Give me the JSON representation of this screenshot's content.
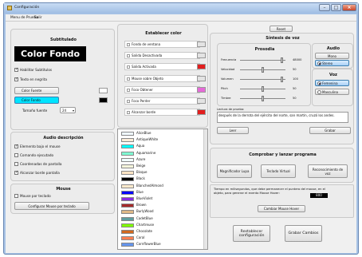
{
  "window": {
    "title": "Configuración"
  },
  "menu": {
    "items": [
      "Menu de Prueba",
      "Salir"
    ]
  },
  "subtitulado": {
    "header": "Subtitulado",
    "preview": "Color Fondo",
    "options": [
      {
        "label": "Habilitar Subtitulos",
        "checked": true
      },
      {
        "label": "Texto en negrita",
        "checked": true
      }
    ],
    "color_rows": [
      {
        "label": "Color Fuente",
        "swatch": "#ffffff",
        "selected": false
      },
      {
        "label": "Color Fondo",
        "swatch": "#000000",
        "selected": true
      }
    ],
    "font_size_label": "Tamaño fuente",
    "font_size_value": "24"
  },
  "audio_desc": {
    "header": "Audio descripción",
    "options": [
      {
        "label": "Elemento bajo el mouse",
        "checked": true
      },
      {
        "label": "Comando ejecutado",
        "checked": false
      },
      {
        "label": "Coordenadas de pantalla",
        "checked": false
      },
      {
        "label": "Alcanzar borde pantalla",
        "checked": true
      }
    ]
  },
  "mouse": {
    "header": "Mouse",
    "option": {
      "label": "Mouse por teclado",
      "checked": false
    },
    "button": "Configurar Mouse por teclado"
  },
  "color_panel": {
    "header": "Establecer color",
    "rows": [
      {
        "label": "Fondo de ventana",
        "swatch": "#e3e3e3"
      },
      {
        "label": "Salida Desactivada",
        "swatch": "#e3e3e3"
      },
      {
        "label": "Salida Activada",
        "swatch": "#e21d1d"
      },
      {
        "label": "Mouse sobre Objeto",
        "swatch": "#e3e3e3"
      },
      {
        "label": "Foco Obtener",
        "swatch": "#e66ad8"
      },
      {
        "label": "Foco Perder",
        "swatch": "#e3e3e3"
      },
      {
        "label": "Alcanzar borde",
        "swatch": "#e21d1d"
      }
    ],
    "list": [
      {
        "name": "AliceBlue",
        "color": "#f0f8ff"
      },
      {
        "name": "AntiqueWhite",
        "color": "#faebd7"
      },
      {
        "name": "Aqua",
        "color": "#00ffff"
      },
      {
        "name": "Aquamarine",
        "color": "#7fffd4"
      },
      {
        "name": "Azure",
        "color": "#f0ffff"
      },
      {
        "name": "Beige",
        "color": "#f5f5dc"
      },
      {
        "name": "Bisque",
        "color": "#ffe4c4"
      },
      {
        "name": "Black",
        "color": "#000000"
      },
      {
        "name": "BlanchedAlmond",
        "color": "#ffebcd"
      },
      {
        "name": "Blue",
        "color": "#0000ff"
      },
      {
        "name": "BlueViolet",
        "color": "#8a2be2"
      },
      {
        "name": "Brown",
        "color": "#a52a2a"
      },
      {
        "name": "BurlyWood",
        "color": "#deb887"
      },
      {
        "name": "CadetBlue",
        "color": "#5f9ea0"
      },
      {
        "name": "Chartreuse",
        "color": "#7fff00"
      },
      {
        "name": "Chocolate",
        "color": "#d2691e"
      },
      {
        "name": "Coral",
        "color": "#ff7f50"
      },
      {
        "name": "CornflowerBlue",
        "color": "#6495ed"
      }
    ]
  },
  "voz": {
    "reset": "Reset",
    "header": "Síntesis de voz",
    "prosodia": {
      "header": "Prosodia",
      "sliders": [
        {
          "label": "Frecuencia",
          "value": "48000",
          "pos": 0.95
        },
        {
          "label": "Velocidad",
          "value": "50",
          "pos": 0.5
        },
        {
          "label": "Volumen",
          "value": "100",
          "pos": 0.95
        },
        {
          "label": "Pitch",
          "value": "50",
          "pos": 0.5
        },
        {
          "label": "Timbre",
          "value": "50",
          "pos": 0.5
        }
      ]
    },
    "audio": {
      "header": "Audio",
      "mono": "Mono",
      "stereo": "Stereo"
    },
    "voz_group": {
      "header": "Voz",
      "femenina": "Femenina",
      "masculina": "Masculina"
    },
    "lectura_label": "Lectura de prueba:",
    "lectura_text": "después de la derrota del ejército del norte, san martín, cruzó los andes.",
    "leer": "Leer",
    "grabar": "Grabar"
  },
  "comprobar": {
    "header": "Comprobar y lanzar programa",
    "buttons": [
      "Magnificador Lupa",
      "Teclado Virtual",
      "Reconocimiento de voz"
    ]
  },
  "hover": {
    "text": "Tiempo en milisegundos, que debe permanecer el puntero del mouse, en el objeto, para generar el evento Mouse Hover:",
    "value": "800",
    "button": "Cambiar Mouse Hover"
  },
  "footer": {
    "restablecer": "Restablecer configuración",
    "grabar": "Grabar Cambios"
  }
}
